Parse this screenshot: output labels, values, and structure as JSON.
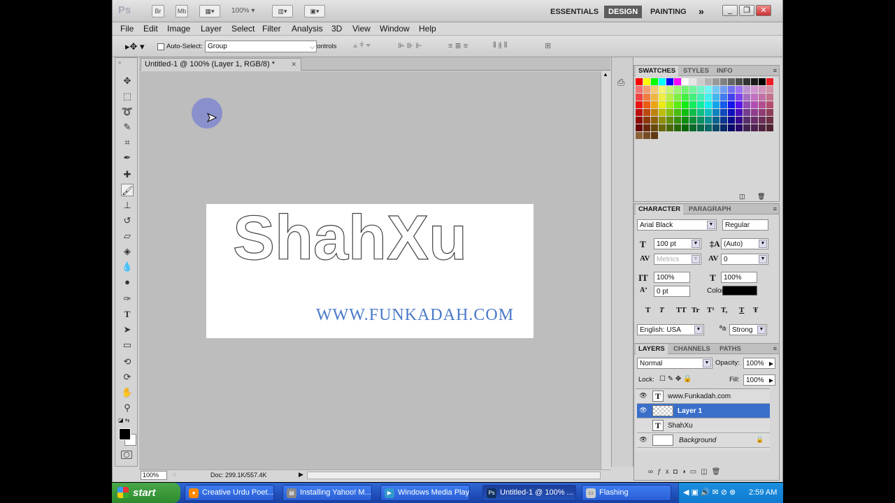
{
  "appbar": {
    "logo": "Ps",
    "btn_br": "Br",
    "btn_mb": "Mb",
    "zoom": "100%",
    "workspaces": [
      "ESSENTIALS",
      "DESIGN",
      "PAINTING"
    ],
    "more": "»"
  },
  "menu": [
    "File",
    "Edit",
    "Image",
    "Layer",
    "Select",
    "Filter",
    "Analysis",
    "3D",
    "View",
    "Window",
    "Help"
  ],
  "options": {
    "auto_select_label": "Auto-Select:",
    "auto_select_value": "Group",
    "controls_label": "ontrols"
  },
  "document": {
    "tab_title": "Untitled-1 @ 100% (Layer 1, RGB/8) *",
    "headline": "ShahXu",
    "website": "WWW.FUNKADAH.COM"
  },
  "status": {
    "zoom": "100%",
    "doc": "Doc: 299.1K/557.4K"
  },
  "swatches_panel": {
    "tabs": [
      "SWATCHES",
      "STYLES",
      "INFO"
    ]
  },
  "character_panel": {
    "tabs": [
      "CHARACTER",
      "PARAGRAPH"
    ],
    "font_family": "Arial Black",
    "font_style": "Regular",
    "size": "100 pt",
    "leading": "(Auto)",
    "kerning": "Metrics",
    "tracking": "0",
    "vscale": "100%",
    "hscale": "100%",
    "baseline": "0 pt",
    "color_label": "Color:",
    "style_buttons": [
      "T",
      "T",
      "TT",
      "Tr",
      "T¹",
      "T,",
      "T",
      "Ŧ"
    ],
    "language": "English: USA",
    "aa_label": "ªa",
    "antialias": "Strong"
  },
  "layers_panel": {
    "tabs": [
      "LAYERS",
      "CHANNELS",
      "PATHS"
    ],
    "blend_mode": "Normal",
    "opacity_label": "Opacity:",
    "opacity": "100%",
    "lock_label": "Lock:",
    "fill_label": "Fill:",
    "fill": "100%",
    "layers": [
      {
        "name": "www.Funkadah.com",
        "type": "text",
        "visible": true
      },
      {
        "name": "Layer 1",
        "type": "pixel",
        "visible": true,
        "selected": true
      },
      {
        "name": "ShahXu",
        "type": "text",
        "visible": false
      },
      {
        "name": "Background",
        "type": "background",
        "visible": true
      }
    ]
  },
  "taskbar": {
    "start": "start",
    "tasks": [
      {
        "label": "Creative Urdu Poet..."
      },
      {
        "label": "Installing Yahoo! M..."
      },
      {
        "label": "Windows Media Player"
      },
      {
        "label": "Untitled-1 @ 100% ...",
        "active": true
      },
      {
        "label": "Flashing"
      }
    ],
    "clock": "2:59 AM"
  },
  "colors": {
    "selected_layer": "#3a6fc9",
    "website_text": "#4a7ac8",
    "taskbar": "#245edb",
    "start": "#3c9a3c"
  }
}
